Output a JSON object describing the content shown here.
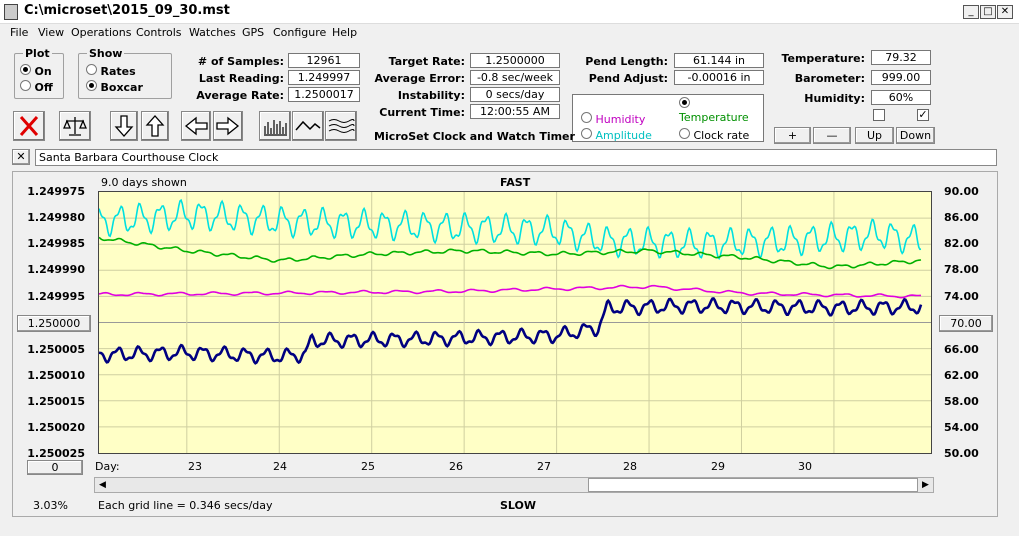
{
  "window": {
    "title": "C:\\microset\\2015_09_30.mst",
    "min": "_",
    "max": "□",
    "close": "✕"
  },
  "menu": [
    "File",
    "View",
    "Operations",
    "Controls",
    "Watches",
    "GPS",
    "Configure",
    "Help"
  ],
  "plot_group": {
    "title": "Plot",
    "on": "On",
    "off": "Off"
  },
  "show_group": {
    "title": "Show",
    "rates": "Rates",
    "boxcar": "Boxcar"
  },
  "stats": {
    "samples_label": "# of Samples:",
    "samples": "12961",
    "last_label": "Last Reading:",
    "last": "1.249997",
    "avg_label": "Average Rate:",
    "avg": "1.2500017",
    "target_label": "Target Rate:",
    "target": "1.2500000",
    "avgerr_label": "Average Error:",
    "avgerr": "-0.8 sec/week",
    "instab_label": "Instability:",
    "instab": "0 secs/day",
    "time_label": "Current Time:",
    "time": "12:00:55 AM",
    "pendlen_label": "Pend Length:",
    "pendlen": "61.144 in",
    "pendadj_label": "Pend Adjust:",
    "pendadj": "-0.00016 in",
    "temp_label": "Temperature:",
    "temp": "79.32",
    "baro_label": "Barometer:",
    "baro": "999.00",
    "hum_label": "Humidity:",
    "hum": "60%"
  },
  "app_caption": "MicroSet Clock and Watch Timer",
  "sensor": {
    "temperature": "Temperature",
    "humidity": "Humidity",
    "amplitude": "Amplitude",
    "clockrate": "Clock rate"
  },
  "adjust": {
    "plus": "+",
    "minus": "—",
    "up": "Up",
    "down": "Down"
  },
  "watch_name": "Santa Barbara Courthouse Clock",
  "close_watch": "✕",
  "chart": {
    "days_shown": "9.0 days shown",
    "fast": "FAST",
    "slow": "SLOW",
    "grid_note": "Each grid line = 0.346 secs/day",
    "percent": "3.03%",
    "day_label": "Day:",
    "left_box": "1.250000",
    "right_box": "70.00",
    "scroll_box": "0"
  },
  "chart_data": {
    "type": "line",
    "left_axis": [
      "1.249975",
      "1.249980",
      "1.249985",
      "1.249990",
      "1.249995",
      "1.250000",
      "1.250005",
      "1.250010",
      "1.250015",
      "1.250020",
      "1.250025"
    ],
    "right_axis": [
      "90.00",
      "86.00",
      "82.00",
      "78.00",
      "74.00",
      "70.00",
      "66.00",
      "62.00",
      "58.00",
      "54.00",
      "50.00"
    ],
    "days": [
      "23",
      "24",
      "25",
      "26",
      "27",
      "28",
      "29",
      "30"
    ],
    "ylim_left": [
      1.249975,
      1.250025
    ],
    "ylim_right": [
      50,
      90
    ],
    "xlim": [
      22.05,
      31.05
    ],
    "series": [
      {
        "color": "#00e0e0",
        "base": [
          [
            22.05,
            85.5
          ],
          [
            23.1,
            86.5
          ],
          [
            24.0,
            85.5
          ],
          [
            25.0,
            85.0
          ],
          [
            26.0,
            84.5
          ],
          [
            27.0,
            84.0
          ],
          [
            27.5,
            82.5
          ],
          [
            28.5,
            82.0
          ],
          [
            29.5,
            82.5
          ],
          [
            30.5,
            83.5
          ],
          [
            30.95,
            82.5
          ]
        ],
        "amp": 1.8,
        "period": 0.22
      },
      {
        "color": "#00b000",
        "base": [
          [
            22.05,
            83.0
          ],
          [
            23.0,
            81.0
          ],
          [
            24.0,
            79.5
          ],
          [
            25.0,
            80.5
          ],
          [
            26.0,
            81.0
          ],
          [
            27.0,
            80.5
          ],
          [
            28.0,
            81.0
          ],
          [
            29.0,
            80.0
          ],
          [
            30.0,
            78.5
          ],
          [
            30.95,
            79.5
          ]
        ],
        "amp": 0.25,
        "period": 0.3
      },
      {
        "color": "#e000e0",
        "base": [
          [
            22.05,
            74.3
          ],
          [
            24.0,
            74.5
          ],
          [
            26.0,
            74.8
          ],
          [
            28.0,
            75.5
          ],
          [
            29.0,
            74.5
          ],
          [
            30.0,
            74.2
          ],
          [
            30.95,
            74.0
          ]
        ],
        "amp": 0.2,
        "period": 0.4
      },
      {
        "color": "#000080",
        "base": [
          [
            22.05,
            1.2500062
          ],
          [
            23.0,
            1.2500058
          ],
          [
            24.0,
            1.2500065
          ],
          [
            24.28,
            1.2500061
          ],
          [
            24.35,
            1.2500035
          ],
          [
            25.5,
            1.2500032
          ],
          [
            27.0,
            1.2500025
          ],
          [
            27.45,
            1.250001
          ],
          [
            27.55,
            1.2499972
          ],
          [
            28.5,
            1.2499968
          ],
          [
            30.0,
            1.2499972
          ],
          [
            30.95,
            1.249997
          ]
        ],
        "amp": 1.1e-06,
        "period": 0.23,
        "axis": "left"
      }
    ]
  }
}
